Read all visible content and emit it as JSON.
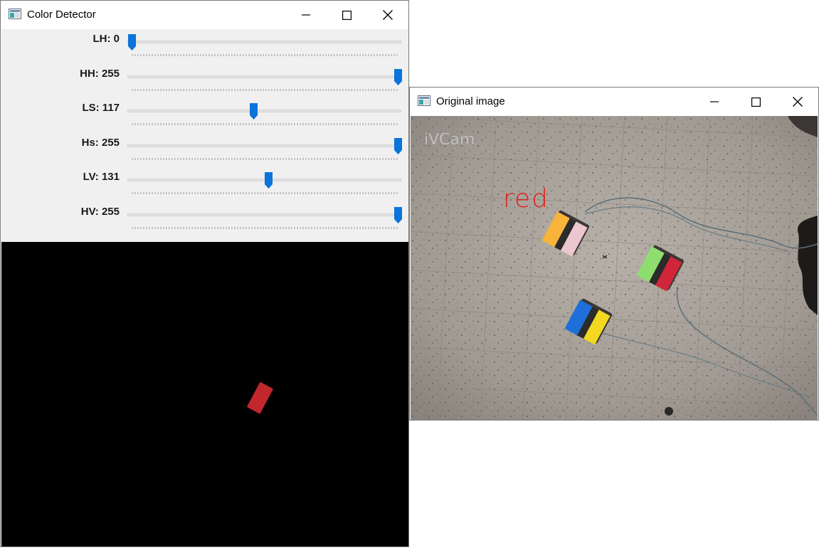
{
  "detector_window": {
    "title": "Color Detector",
    "trackbars": [
      {
        "label": "LH: 0",
        "fraction": 0.0
      },
      {
        "label": "HH: 255",
        "fraction": 1.0
      },
      {
        "label": "LS: 117",
        "fraction": 0.459
      },
      {
        "label": "Hs: 255",
        "fraction": 1.0
      },
      {
        "label": "LV: 131",
        "fraction": 0.514
      },
      {
        "label": "HV: 255",
        "fraction": 1.0
      }
    ],
    "mask_blob_color": "#c1272d"
  },
  "original_window": {
    "title": "Original image",
    "watermark": "iVCam",
    "detected_label": "red",
    "detected_label_color": "#e0201c",
    "robots": [
      {
        "colors": [
          "#f7b33a",
          "#2b2b2b",
          "#ecc7cf"
        ]
      },
      {
        "colors": [
          "#8ede6f",
          "#2b2b2b",
          "#d1263a"
        ]
      },
      {
        "colors": [
          "#1e6fd9",
          "#2b2b2b",
          "#f2d820"
        ]
      }
    ]
  },
  "theme": {
    "accent": "#0a74da",
    "panel_bg": "#f0f0f0",
    "floor": "#a29c94"
  }
}
